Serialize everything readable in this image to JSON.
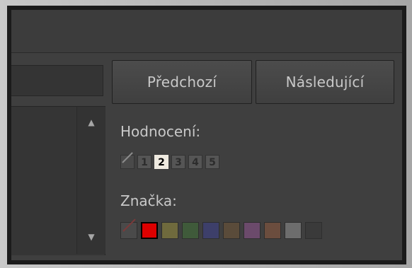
{
  "navigation": {
    "previous_label": "Předchozí",
    "next_label": "Následující"
  },
  "rating": {
    "label": "Hodnocení:",
    "none_label": "none",
    "items": [
      "1",
      "2",
      "3",
      "4",
      "5"
    ],
    "selected": 2
  },
  "color_label": {
    "label": "Značka:",
    "swatches": [
      {
        "name": "none",
        "color": "#4a4a4a",
        "selected": false
      },
      {
        "name": "red",
        "color": "#dd0000",
        "selected": true
      },
      {
        "name": "yellow",
        "color": "#6f6a3d",
        "selected": false
      },
      {
        "name": "green",
        "color": "#3f5a3a",
        "selected": false
      },
      {
        "name": "blue",
        "color": "#3d3f6a",
        "selected": false
      },
      {
        "name": "brown",
        "color": "#5a4b3a",
        "selected": false
      },
      {
        "name": "purple",
        "color": "#6b4a6b",
        "selected": false
      },
      {
        "name": "orange",
        "color": "#6b4d3e",
        "selected": false
      },
      {
        "name": "gray",
        "color": "#6d6d6d",
        "selected": false
      },
      {
        "name": "dark",
        "color": "#3a3a3a",
        "selected": false
      }
    ]
  },
  "scrollbar": {
    "up_icon": "▲",
    "down_icon": "▼"
  }
}
